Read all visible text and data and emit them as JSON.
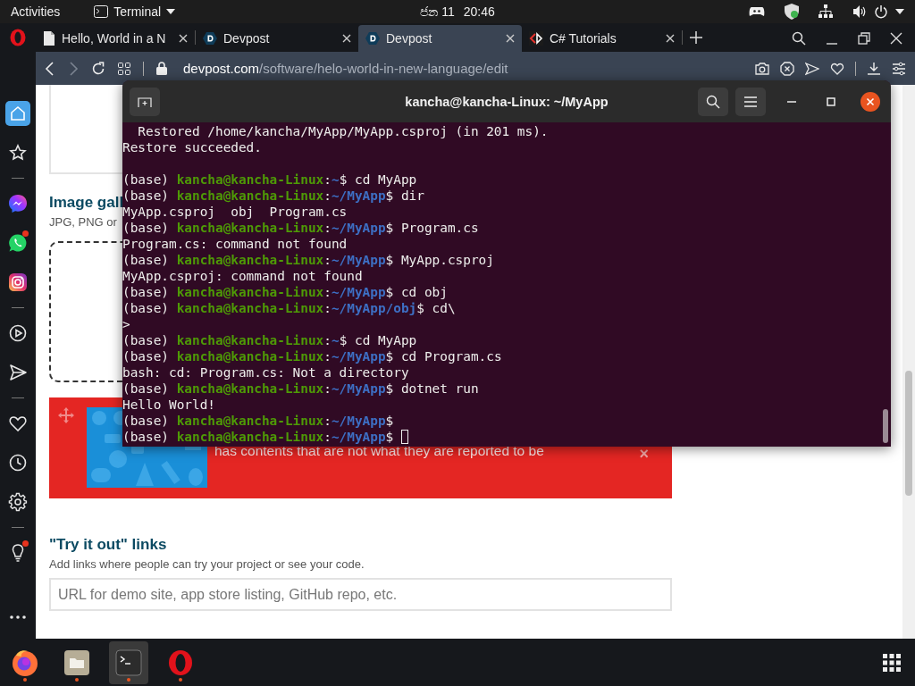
{
  "top_bar": {
    "activities": "Activities",
    "app_menu": "Terminal",
    "date": "ජන 11",
    "time": "20:46"
  },
  "browser": {
    "tabs": [
      {
        "title": "Hello, World in a N",
        "kind": "document",
        "selected": false
      },
      {
        "title": "Devpost",
        "kind": "devpost",
        "selected": false
      },
      {
        "title": "Devpost",
        "kind": "devpost",
        "selected": true
      },
      {
        "title": "C# Tutorials",
        "kind": "code",
        "selected": false
      }
    ],
    "address": {
      "host": "devpost.com",
      "path": "/software/helo-world-in-new-language/edit"
    },
    "sidebar": {
      "items": [
        {
          "kind": "home",
          "selected": true,
          "badge": false
        },
        {
          "kind": "star",
          "selected": false,
          "badge": false
        },
        {
          "kind": "divider"
        },
        {
          "kind": "messenger",
          "selected": false,
          "badge": false
        },
        {
          "kind": "whatsapp",
          "selected": false,
          "badge": true
        },
        {
          "kind": "instagram",
          "selected": false,
          "badge": false
        },
        {
          "kind": "divider"
        },
        {
          "kind": "player",
          "selected": false,
          "badge": false
        },
        {
          "kind": "send",
          "selected": false,
          "badge": false
        },
        {
          "kind": "divider"
        },
        {
          "kind": "heart",
          "selected": false,
          "badge": false
        },
        {
          "kind": "history",
          "selected": false,
          "badge": false
        },
        {
          "kind": "settings",
          "selected": false,
          "badge": false
        },
        {
          "kind": "divider"
        },
        {
          "kind": "bulb",
          "selected": false,
          "badge": true
        },
        {
          "kind": "more",
          "selected": false,
          "badge": false
        }
      ]
    },
    "page": {
      "gallery_heading": "Image gall",
      "gallery_hint": "JPG, PNG or",
      "banner": {
        "message": "has contents that are not what they are reported to be",
        "close": "×"
      },
      "links_heading": "\"Try it out\" links",
      "links_hint": "Add links where people can try your project or see your code.",
      "links_field": {
        "placeholder": "URL for demo site, app store listing, GitHub repo, etc."
      }
    }
  },
  "terminal": {
    "title": "kancha@kancha-Linux: ~/MyApp",
    "lines": [
      {
        "kind": "output",
        "text": "  Restored /home/kancha/MyApp/MyApp.csproj (in 201 ms)."
      },
      {
        "kind": "output",
        "text": "Restore succeeded."
      },
      {
        "kind": "blank"
      },
      {
        "kind": "prompt",
        "env": "(base)",
        "user": "kancha@kancha-Linux",
        "sep": ":",
        "path": "~",
        "sigil": "$",
        "command": "cd MyApp",
        "cursor": false
      },
      {
        "kind": "prompt",
        "env": "(base)",
        "user": "kancha@kancha-Linux",
        "sep": ":",
        "path": "~/MyApp",
        "sigil": "$",
        "command": "dir",
        "cursor": false
      },
      {
        "kind": "output",
        "text": "MyApp.csproj  obj  Program.cs"
      },
      {
        "kind": "prompt",
        "env": "(base)",
        "user": "kancha@kancha-Linux",
        "sep": ":",
        "path": "~/MyApp",
        "sigil": "$",
        "command": "Program.cs",
        "cursor": false
      },
      {
        "kind": "output",
        "text": "Program.cs: command not found"
      },
      {
        "kind": "prompt",
        "env": "(base)",
        "user": "kancha@kancha-Linux",
        "sep": ":",
        "path": "~/MyApp",
        "sigil": "$",
        "command": "MyApp.csproj",
        "cursor": false
      },
      {
        "kind": "output",
        "text": "MyApp.csproj: command not found"
      },
      {
        "kind": "prompt",
        "env": "(base)",
        "user": "kancha@kancha-Linux",
        "sep": ":",
        "path": "~/MyApp",
        "sigil": "$",
        "command": "cd obj",
        "cursor": false
      },
      {
        "kind": "prompt",
        "env": "(base)",
        "user": "kancha@kancha-Linux",
        "sep": ":",
        "path": "~/MyApp/obj",
        "sigil": "$",
        "command": "cd\\",
        "cursor": false
      },
      {
        "kind": "output",
        "text": ">"
      },
      {
        "kind": "prompt",
        "env": "(base)",
        "user": "kancha@kancha-Linux",
        "sep": ":",
        "path": "~",
        "sigil": "$",
        "command": "cd MyApp",
        "cursor": false
      },
      {
        "kind": "prompt",
        "env": "(base)",
        "user": "kancha@kancha-Linux",
        "sep": ":",
        "path": "~/MyApp",
        "sigil": "$",
        "command": "cd Program.cs",
        "cursor": false
      },
      {
        "kind": "output",
        "text": "bash: cd: Program.cs: Not a directory"
      },
      {
        "kind": "prompt",
        "env": "(base)",
        "user": "kancha@kancha-Linux",
        "sep": ":",
        "path": "~/MyApp",
        "sigil": "$",
        "command": "dotnet run",
        "cursor": false
      },
      {
        "kind": "output",
        "text": "Hello World!"
      },
      {
        "kind": "prompt",
        "env": "(base)",
        "user": "kancha@kancha-Linux",
        "sep": ":",
        "path": "~/MyApp",
        "sigil": "$",
        "cursor": false
      },
      {
        "kind": "prompt",
        "env": "(base)",
        "user": "kancha@kancha-Linux",
        "sep": ":",
        "path": "~/MyApp",
        "sigil": "$",
        "cursor": true
      }
    ]
  },
  "taskbar": {
    "apps": [
      {
        "kind": "firefox",
        "running": true,
        "selected": false
      },
      {
        "kind": "files",
        "running": true,
        "selected": false
      },
      {
        "kind": "terminal",
        "running": true,
        "selected": true
      },
      {
        "kind": "opera",
        "running": true,
        "selected": false
      }
    ]
  }
}
